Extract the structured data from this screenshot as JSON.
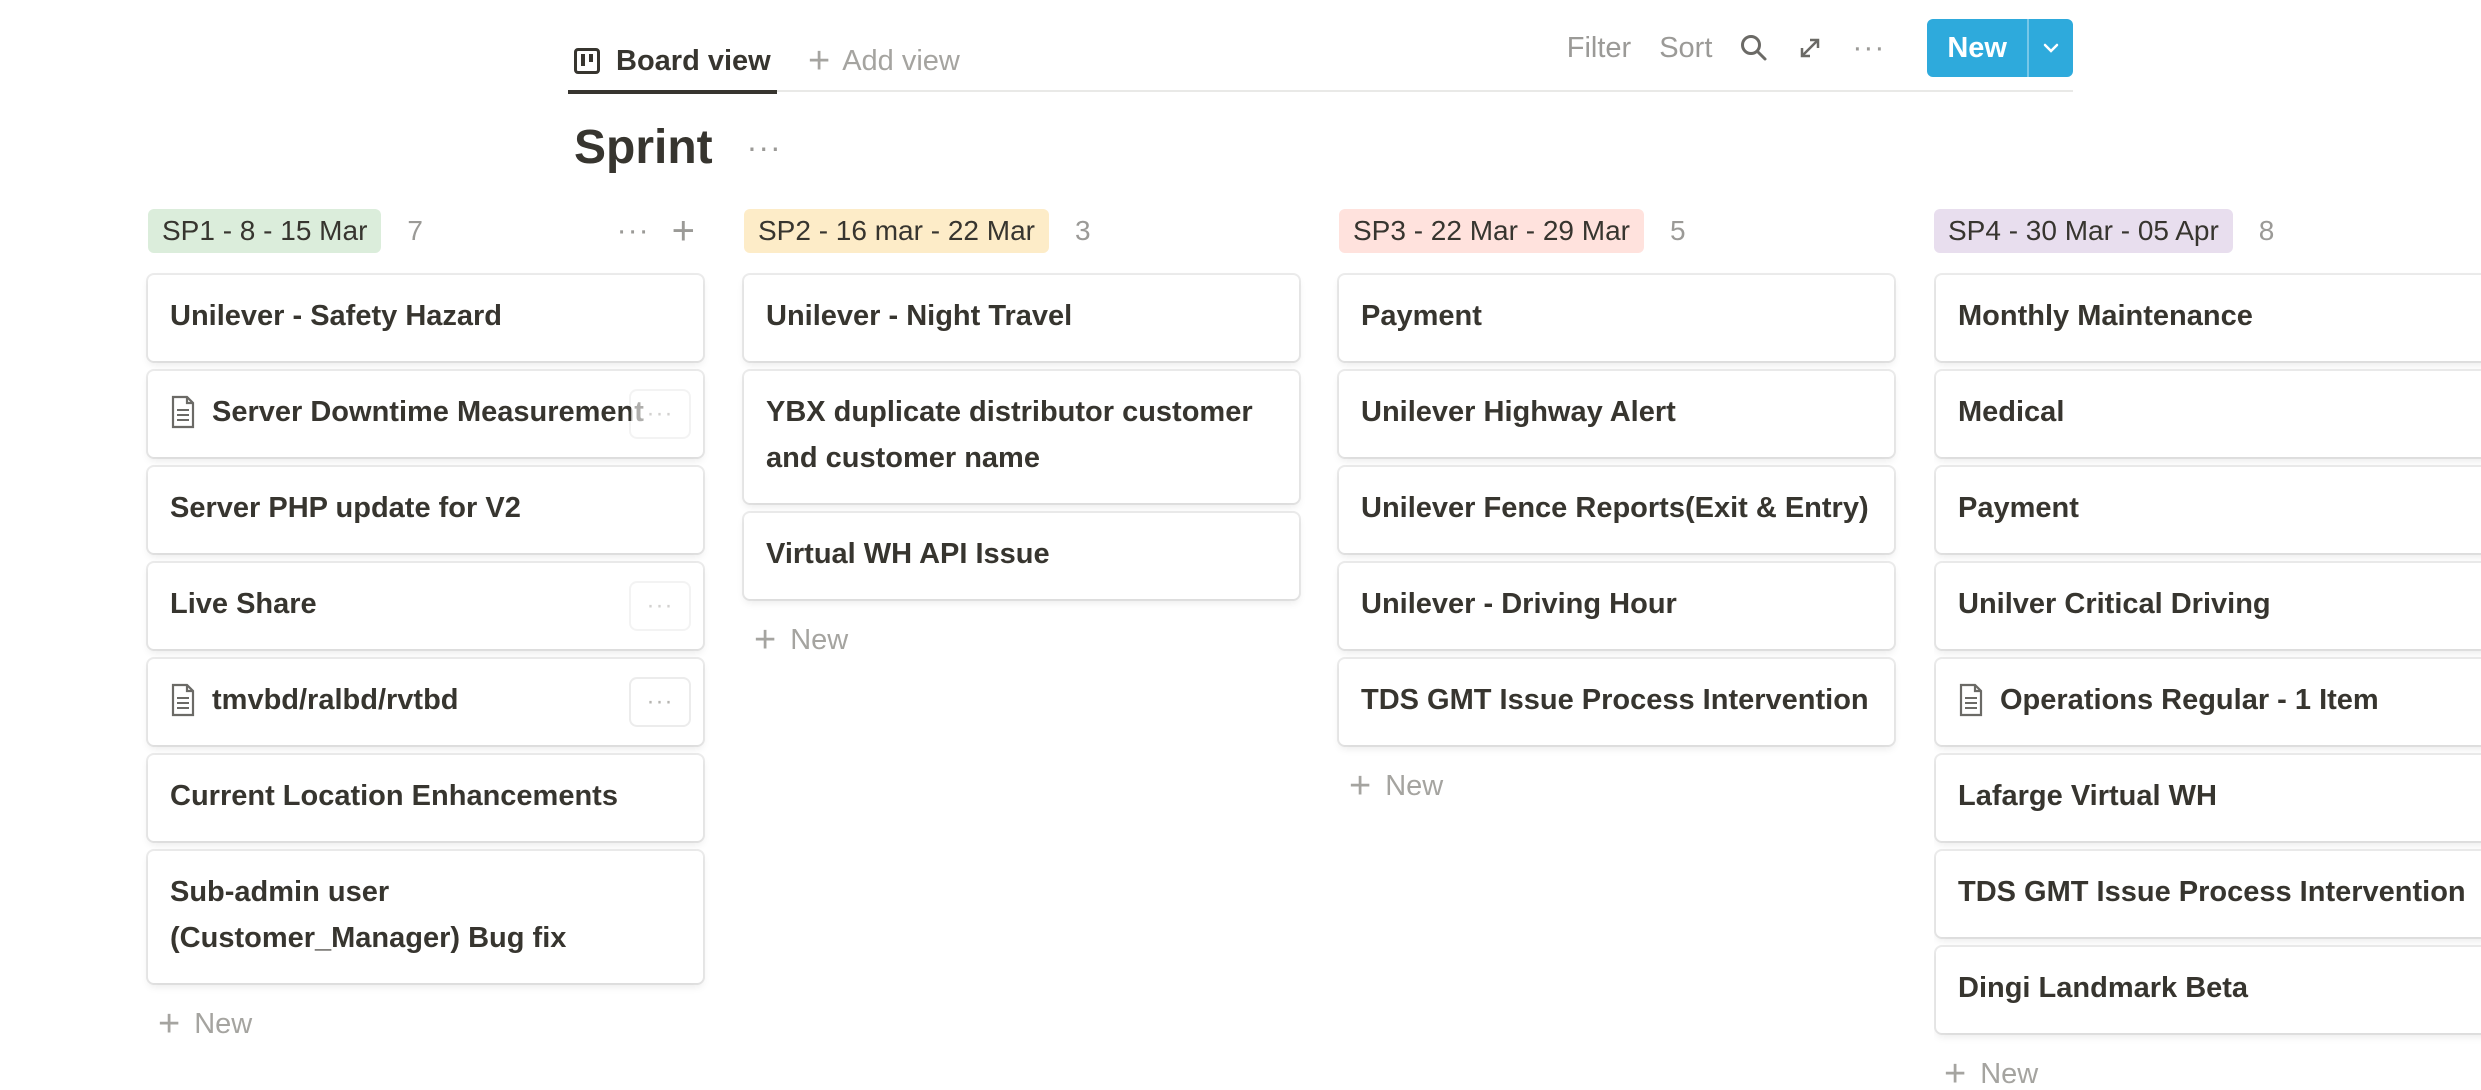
{
  "viewbar": {
    "board_view_label": "Board view",
    "add_view_label": "Add view",
    "filter_label": "Filter",
    "sort_label": "Sort",
    "more_label": "···",
    "new_label": "New"
  },
  "title": {
    "text": "Sprint",
    "more_label": "···"
  },
  "colors": {
    "accent": "#2eaadc",
    "tag_green": "#dbeddb",
    "tag_yellow": "#fdecc8",
    "tag_red": "#ffe2dd",
    "tag_purple": "#e8deee"
  },
  "columns": [
    {
      "name": "SP1 - 8 - 15 Mar",
      "count": "7",
      "tag_color": "#dbeddb",
      "new_label": "New",
      "cards": [
        {
          "title": "Unilever - Safety Hazard"
        },
        {
          "title": "Server Downtime Measurement",
          "icon": "document-icon"
        },
        {
          "title": "Server PHP update for V2"
        },
        {
          "title": "Live Share"
        },
        {
          "title": "tmvbd/ralbd/rvtbd",
          "icon": "document-icon"
        },
        {
          "title": "Current Location Enhancements"
        },
        {
          "title": "Sub-admin user (Customer_Manager) Bug fix"
        }
      ]
    },
    {
      "name": "SP2 - 16 mar - 22 Mar",
      "count": "3",
      "tag_color": "#fdecc8",
      "new_label": "New",
      "cards": [
        {
          "title": "Unilever - Night Travel"
        },
        {
          "title": "YBX duplicate distributor customer and customer name"
        },
        {
          "title": "Virtual WH API Issue"
        }
      ]
    },
    {
      "name": "SP3 - 22 Mar - 29 Mar",
      "count": "5",
      "tag_color": "#ffe2dd",
      "new_label": "New",
      "cards": [
        {
          "title": "Payment"
        },
        {
          "title": "Unilever Highway Alert"
        },
        {
          "title": "Unilever Fence Reports(Exit & Entry)"
        },
        {
          "title": "Unilever - Driving Hour"
        },
        {
          "title": "TDS GMT Issue Process Intervention"
        }
      ]
    },
    {
      "name": "SP4 - 30 Mar - 05 Apr",
      "count": "8",
      "tag_color": "#e8deee",
      "new_label": "New",
      "cards": [
        {
          "title": "Monthly Maintenance"
        },
        {
          "title": "Medical"
        },
        {
          "title": "Payment"
        },
        {
          "title": "Unilver Critical Driving"
        },
        {
          "title": "Operations Regular - 1 Item",
          "icon": "document-icon"
        },
        {
          "title": "Lafarge Virtual WH"
        },
        {
          "title": "TDS GMT Issue Process Intervention"
        },
        {
          "title": "Dingi Landmark Beta"
        }
      ]
    }
  ]
}
